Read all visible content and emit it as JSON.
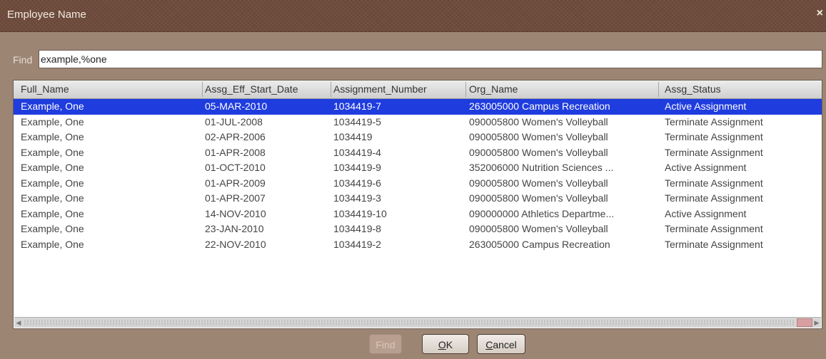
{
  "window": {
    "title": "Employee Name",
    "close_glyph": "×"
  },
  "find": {
    "label": "Find",
    "value": "example,%one"
  },
  "table": {
    "columns": [
      "Full_Name",
      "Assg_Eff_Start_Date",
      "Assignment_Number",
      "Org_Name",
      "Assg_Status"
    ],
    "selected_row": 0,
    "rows": [
      [
        "Example, One",
        "05-MAR-2010",
        "1034419-7",
        "263005000 Campus Recreation",
        "Active Assignment"
      ],
      [
        "Example, One",
        "01-JUL-2008",
        "1034419-5",
        "090005800 Women's Volleyball",
        "Terminate Assignment"
      ],
      [
        "Example, One",
        "02-APR-2006",
        "1034419",
        "090005800 Women's Volleyball",
        "Terminate Assignment"
      ],
      [
        "Example, One",
        "01-APR-2008",
        "1034419-4",
        "090005800 Women's Volleyball",
        "Terminate Assignment"
      ],
      [
        "Example, One",
        "01-OCT-2010",
        "1034419-9",
        "352006000 Nutrition Sciences ...",
        "Active Assignment"
      ],
      [
        "Example, One",
        "01-APR-2009",
        "1034419-6",
        "090005800 Women's Volleyball",
        "Terminate Assignment"
      ],
      [
        "Example, One",
        "01-APR-2007",
        "1034419-3",
        "090005800 Women's Volleyball",
        "Terminate Assignment"
      ],
      [
        "Example, One",
        "14-NOV-2010",
        "1034419-10",
        "090000000 Athletics Departme...",
        "Active Assignment"
      ],
      [
        "Example, One",
        "23-JAN-2010",
        "1034419-8",
        "090005800 Women's Volleyball",
        "Terminate Assignment"
      ],
      [
        "Example, One",
        "22-NOV-2010",
        "1034419-2",
        "263005000 Campus Recreation",
        "Terminate Assignment"
      ]
    ]
  },
  "buttons": {
    "find": "Find",
    "ok_mnemonic": "O",
    "ok_rest": "K",
    "cancel_mnemonic": "C",
    "cancel_rest": "ancel"
  },
  "colors": {
    "background": "#9d8574",
    "titlebar": "#6e4b3c",
    "selection": "#1f3cde"
  }
}
